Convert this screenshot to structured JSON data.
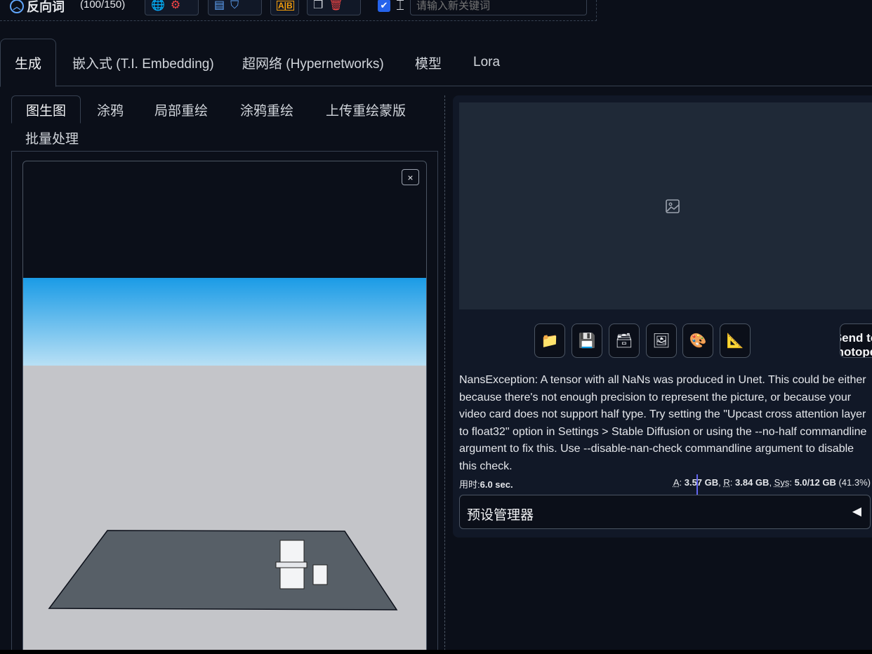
{
  "toolbar": {
    "title": "反向词",
    "token_count": "(100/150)",
    "keyword_placeholder": "请输入新关键词",
    "keyword_checkbox_checked": true,
    "icons": [
      "globe-icon",
      "gear-icon",
      "document-settings-icon",
      "bookmark-icon",
      "spellcheck-icon",
      "copy-icon",
      "trash-icon",
      "checkbox-icon",
      "text-cursor-icon"
    ]
  },
  "main_tabs": [
    {
      "label": "生成",
      "active": true
    },
    {
      "label": "嵌入式 (T.I. Embedding)",
      "active": false
    },
    {
      "label": "超网络 (Hypernetworks)",
      "active": false
    },
    {
      "label": "模型",
      "active": false
    },
    {
      "label": "Lora",
      "active": false
    }
  ],
  "sub_tabs": [
    {
      "label": "图生图",
      "active": true
    },
    {
      "label": "涂鸦",
      "active": false
    },
    {
      "label": "局部重绘",
      "active": false
    },
    {
      "label": "涂鸦重绘",
      "active": false
    },
    {
      "label": "上传重绘蒙版",
      "active": false
    },
    {
      "label": "批量处理",
      "active": false
    }
  ],
  "image_panel": {
    "close_symbol": "×"
  },
  "output_panel": {
    "tool_buttons": [
      {
        "name": "folder-icon",
        "glyph": "📁"
      },
      {
        "name": "save-icon",
        "glyph": "💾"
      },
      {
        "name": "zip-save-icon",
        "glyph": "🗃"
      },
      {
        "name": "send-to-img2img-icon",
        "glyph": "🖼"
      },
      {
        "name": "send-to-inpaint-icon",
        "glyph": "🎨"
      },
      {
        "name": "send-to-extras-icon",
        "glyph": "📐"
      }
    ],
    "send_photopea_label": "Send to Photopea",
    "error_message": "NansException: A tensor with all NaNs was produced in Unet. This could be either because there's not enough precision to represent the picture, or because your video card does not support half type. Try setting the \"Upcast cross attention layer to float32\" option in Settings > Stable Diffusion or using the --no-half commandline argument to fix this. Use --disable-nan-check commandline argument to disable this check.",
    "time_label": "用时:",
    "time_value": "6.0 sec.",
    "mem": {
      "a_label": "A",
      "a_value": "3.57 GB",
      "r_label": "R",
      "r_value": "3.84 GB",
      "sys_label": "Sys",
      "sys_value": "5.0/12 GB",
      "sys_percent": "(41.3%)"
    },
    "preset_label": "预设管理器",
    "preset_arrow": "◀"
  },
  "colors": {
    "background": "#0b0f19",
    "panel": "#111827",
    "accent": "#2563eb",
    "sky_top": "#1a9be6",
    "ground": "#c4c5c9",
    "floor": "#575f67"
  }
}
